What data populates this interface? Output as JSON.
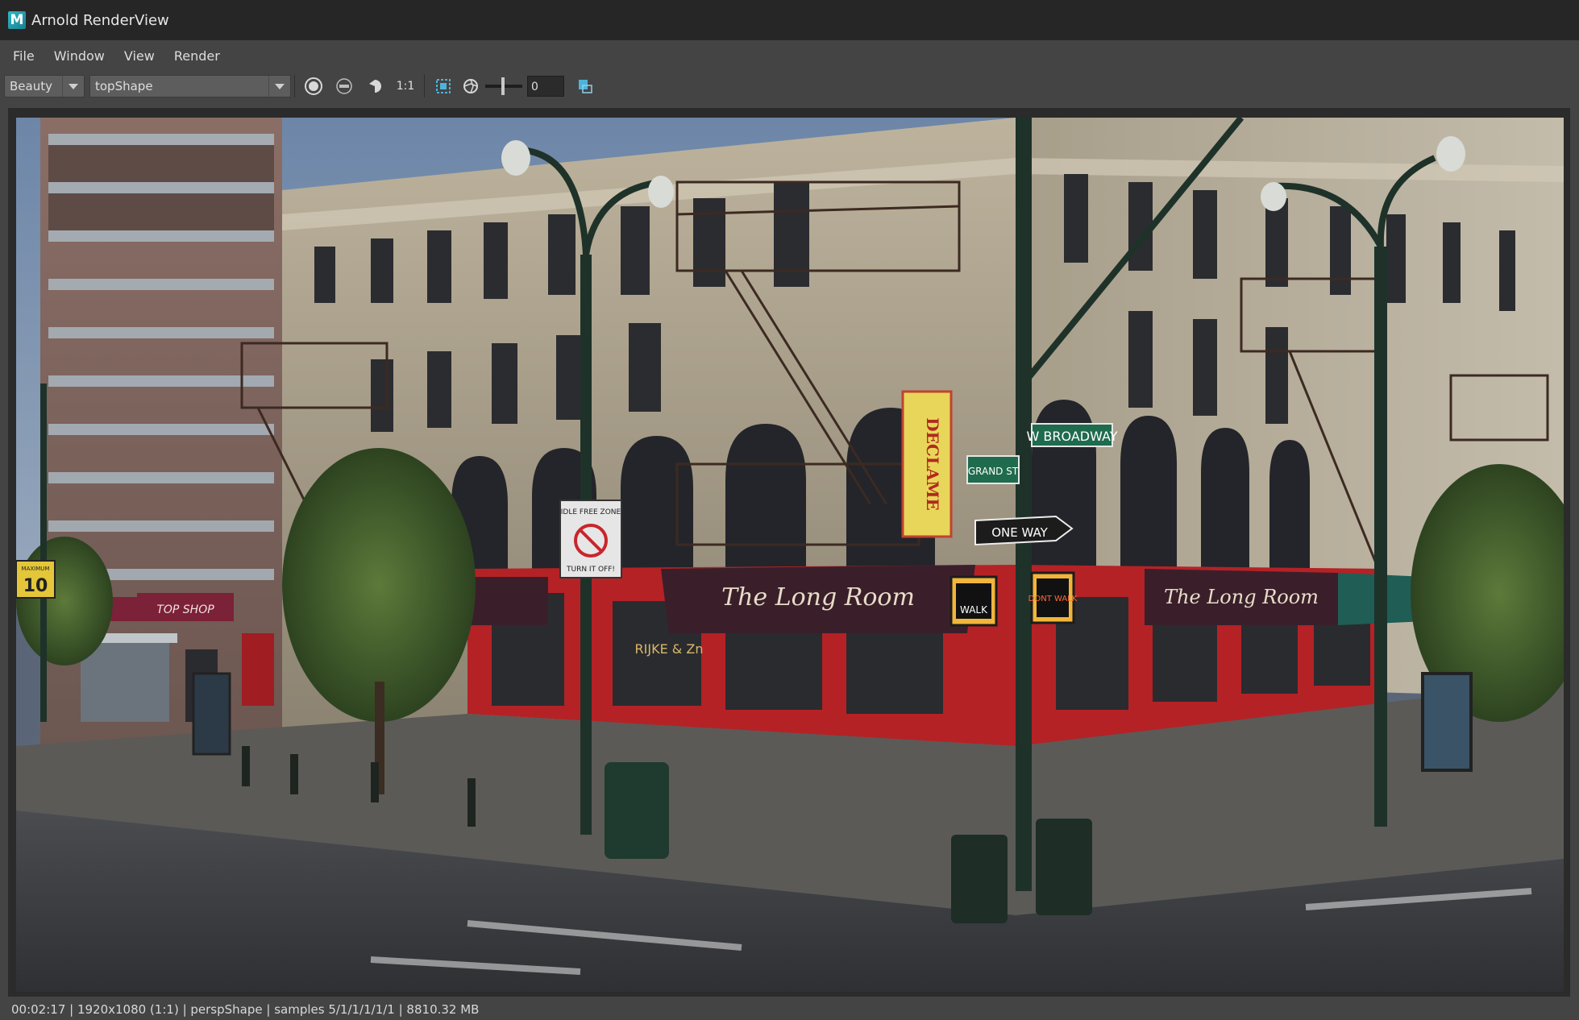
{
  "window": {
    "title": "Arnold RenderView",
    "logo_letter": "M"
  },
  "menu": [
    "File",
    "Window",
    "View",
    "Render"
  ],
  "toolbar": {
    "aov_select": "Beauty",
    "camera_select": "topShape",
    "ratio_label": "1:1",
    "exposure_value": "0"
  },
  "render": {
    "signs": {
      "idle_top": "IDLE FREE ZONE",
      "idle_bottom": "TURN IT OFF!",
      "w_broadway": "W BROADWAY",
      "grand_st": "GRAND ST",
      "one_way": "ONE WAY",
      "walk": "WALK",
      "dont_walk": "DONT WALK",
      "speed_top": "MAXIMUM",
      "speed_value": "10",
      "vertical_sign": "DECLAME",
      "awning_1": "The Long Room",
      "awning_2": "The Long Room",
      "top_shop": "TOP SHOP",
      "window_text": "RIJKE & Zn"
    }
  },
  "status": "00:02:17 | 1920x1080 (1:1) | perspShape  | samples 5/1/1/1/1/1 | 8810.32 MB"
}
